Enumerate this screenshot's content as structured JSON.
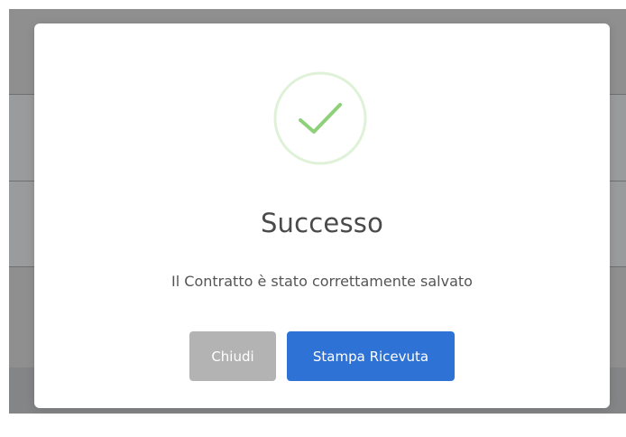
{
  "dialog": {
    "title": "Successo",
    "message": "Il Contratto è stato correttamente salvato",
    "icon": "success-check-icon",
    "buttons": {
      "close_label": "Chiudi",
      "print_label": "Stampa Ricevuta"
    }
  },
  "colors": {
    "success_green": "#8fd17a",
    "success_ring": "#dff2d8",
    "primary_blue": "#2f72d6",
    "secondary_gray": "#b3b3b3",
    "overlay_gray": "#8f8f90"
  }
}
